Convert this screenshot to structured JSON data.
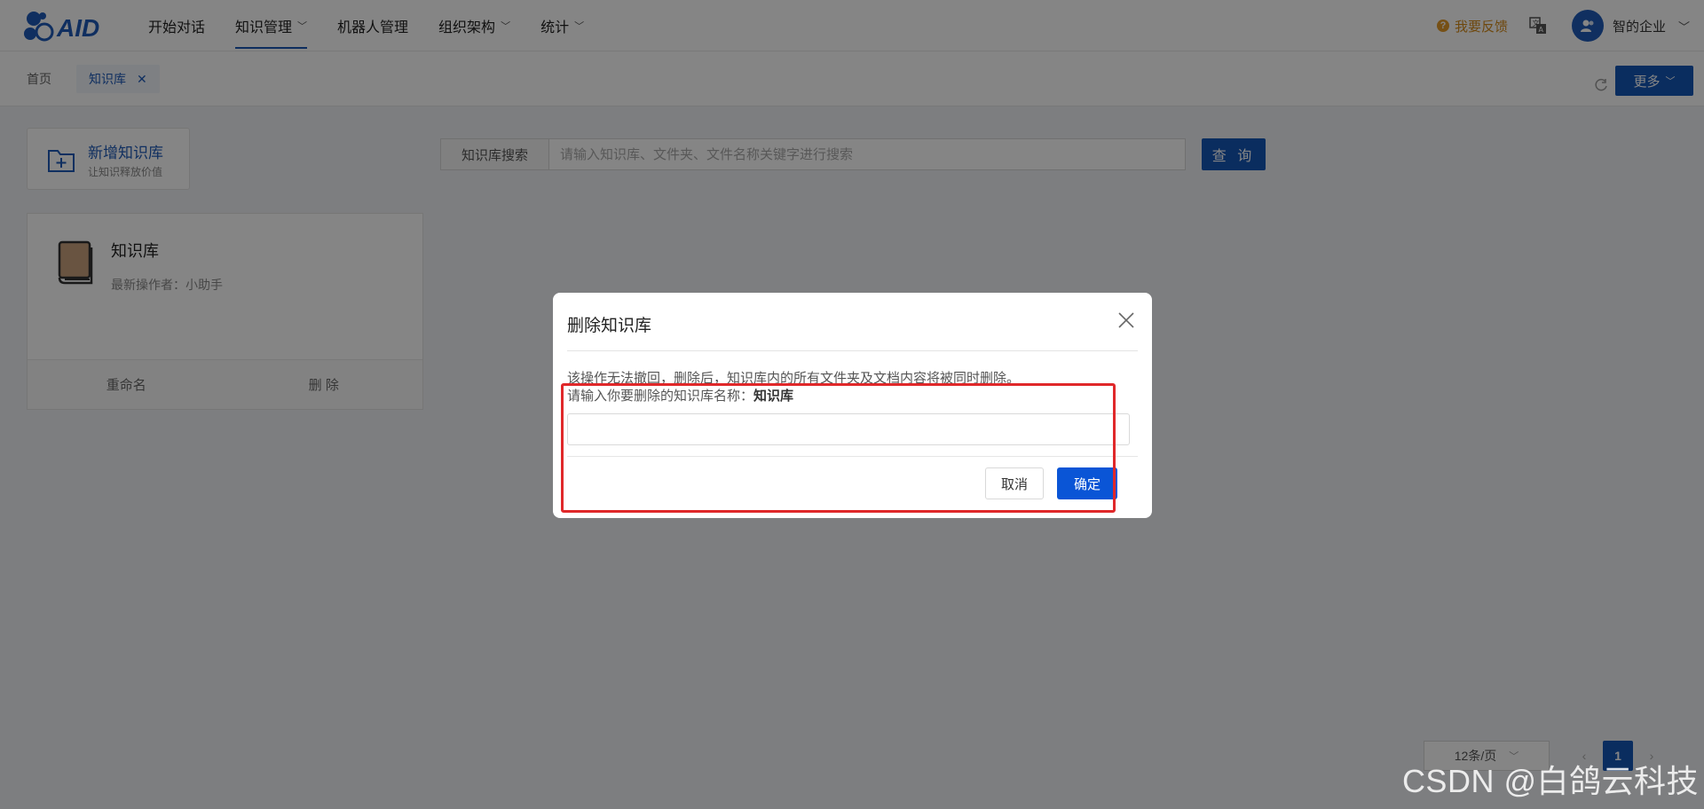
{
  "header": {
    "logo_text": "AID",
    "nav": [
      {
        "label": "开始对话",
        "has_dropdown": false,
        "active": false
      },
      {
        "label": "知识管理",
        "has_dropdown": true,
        "active": true
      },
      {
        "label": "机器人管理",
        "has_dropdown": false,
        "active": false
      },
      {
        "label": "组织架构",
        "has_dropdown": true,
        "active": false
      },
      {
        "label": "统计",
        "has_dropdown": true,
        "active": false
      }
    ],
    "feedback_label": "我要反馈",
    "user_name": "智的企业",
    "icons": {
      "feedback": "question-circle-icon",
      "language": "translate-icon",
      "avatar": "user-group-icon"
    }
  },
  "tabs": {
    "home": "首页",
    "current": "知识库",
    "more_label": "更多"
  },
  "toolbar": {
    "add_title": "新增知识库",
    "add_subtitle": "让知识释放价值",
    "search_label": "知识库搜索",
    "search_placeholder": "请输入知识库、文件夹、文件名称关键字进行搜索",
    "search_value": "",
    "query_button": "查 询"
  },
  "kb_list": [
    {
      "name": "知识库",
      "operator_label": "最新操作者：小助手",
      "rename": "重命名",
      "delete": "删 除"
    }
  ],
  "pagination": {
    "page_size": "12条/页",
    "prev": "‹",
    "current_page": "1",
    "next": "›"
  },
  "modal": {
    "title": "删除知识库",
    "warning": "该操作无法撤回，删除后，知识库内的所有文件夹及文档内容将被同时删除。",
    "prompt": "请输入你要删除的知识库名称：",
    "prompt_name": "知识库",
    "input_value": "",
    "cancel": "取消",
    "confirm": "确定"
  },
  "watermark": "CSDN @白鸽云科技",
  "colors": {
    "primary": "#1556b6",
    "confirm": "#0a55d6",
    "highlight": "#e0282a",
    "feedback": "#d48a1a"
  }
}
